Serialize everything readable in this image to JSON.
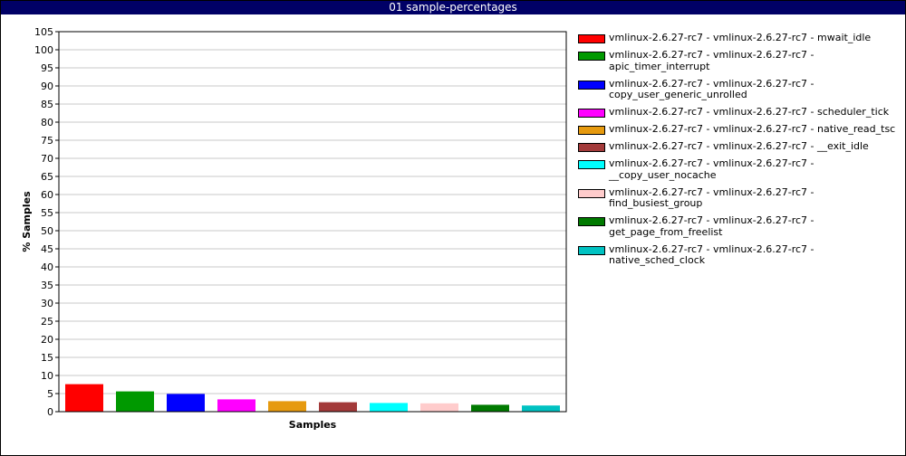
{
  "window": {
    "title": "01 sample-percentages"
  },
  "chart_data": {
    "type": "bar",
    "title": "01 sample-percentages",
    "xlabel": "Samples",
    "ylabel": "% Samples",
    "ylim": [
      0,
      105
    ],
    "ytick_step": 5,
    "grid": true,
    "legend_position": "right",
    "series": [
      {
        "name": "vmlinux-2.6.27-rc7 - vmlinux-2.6.27-rc7 - mwait_idle",
        "value": 7.6,
        "color": "#ff0000"
      },
      {
        "name": "vmlinux-2.6.27-rc7 - vmlinux-2.6.27-rc7 - apic_timer_interrupt",
        "value": 5.6,
        "color": "#009900"
      },
      {
        "name": "vmlinux-2.6.27-rc7 - vmlinux-2.6.27-rc7 - copy_user_generic_unrolled",
        "value": 4.9,
        "color": "#0000ff"
      },
      {
        "name": "vmlinux-2.6.27-rc7 - vmlinux-2.6.27-rc7 - scheduler_tick",
        "value": 3.4,
        "color": "#ff00ff"
      },
      {
        "name": "vmlinux-2.6.27-rc7 - vmlinux-2.6.27-rc7 - native_read_tsc",
        "value": 2.9,
        "color": "#e69a0f"
      },
      {
        "name": "vmlinux-2.6.27-rc7 - vmlinux-2.6.27-rc7 - __exit_idle",
        "value": 2.6,
        "color": "#a33a3a"
      },
      {
        "name": "vmlinux-2.6.27-rc7 - vmlinux-2.6.27-rc7 - __copy_user_nocache",
        "value": 2.4,
        "color": "#00ffff"
      },
      {
        "name": "vmlinux-2.6.27-rc7 - vmlinux-2.6.27-rc7 - find_busiest_group",
        "value": 2.3,
        "color": "#ffcccc"
      },
      {
        "name": "vmlinux-2.6.27-rc7 - vmlinux-2.6.27-rc7 - get_page_from_freelist",
        "value": 1.9,
        "color": "#007a00"
      },
      {
        "name": "vmlinux-2.6.27-rc7 - vmlinux-2.6.27-rc7 - native_sched_clock",
        "value": 1.7,
        "color": "#00c2c2"
      }
    ]
  }
}
